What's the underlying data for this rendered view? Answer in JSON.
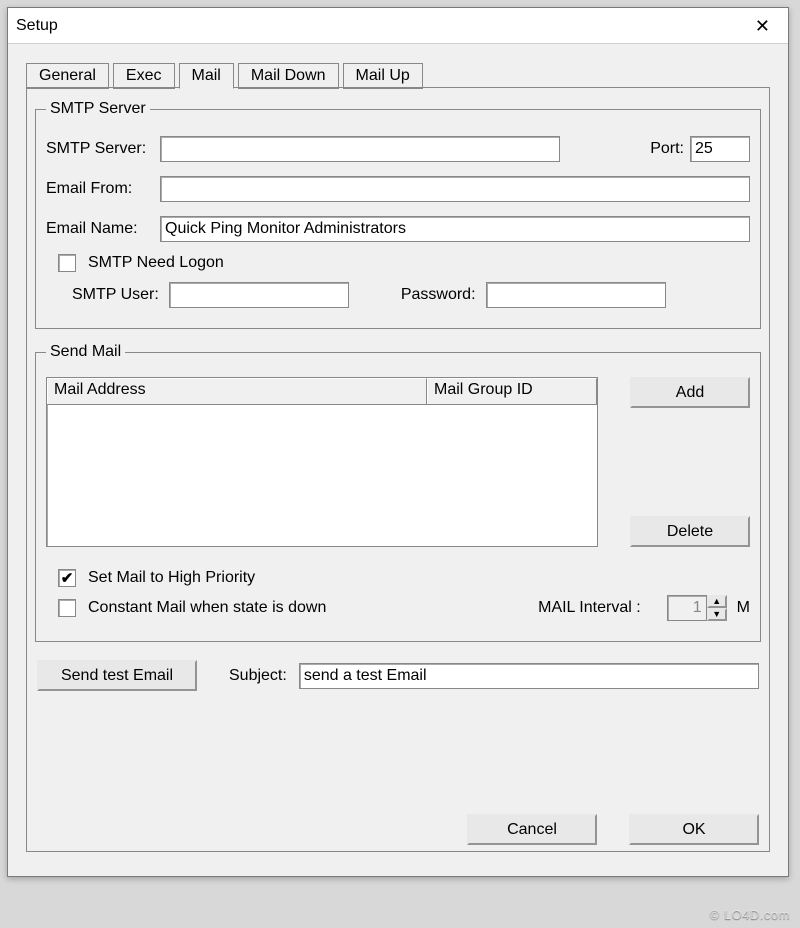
{
  "window": {
    "title": "Setup"
  },
  "tabs": {
    "general": "General",
    "exec": "Exec",
    "mail": "Mail",
    "maildown": "Mail Down",
    "mailup": "Mail Up"
  },
  "smtp": {
    "legend": "SMTP Server",
    "server_label": "SMTP Server:",
    "server_value": "",
    "port_label": "Port:",
    "port_value": "25",
    "emailfrom_label": "Email From:",
    "emailfrom_value": "",
    "emailname_label": "Email Name:",
    "emailname_value": "Quick Ping Monitor Administrators",
    "needlogon_label": "SMTP Need Logon",
    "needlogon_checked": false,
    "user_label": "SMTP User:",
    "user_value": "",
    "password_label": "Password:",
    "password_value": ""
  },
  "sendmail": {
    "legend": "Send Mail",
    "col_address": "Mail Address",
    "col_group": "Mail Group ID",
    "add_label": "Add",
    "delete_label": "Delete",
    "highprio_label": "Set Mail to High Priority",
    "highprio_checked": true,
    "constant_label": "Constant Mail when state is down",
    "constant_checked": false,
    "interval_label": "MAIL Interval :",
    "interval_value": "1",
    "interval_unit": "M"
  },
  "test": {
    "button_label": "Send test Email",
    "subject_label": "Subject:",
    "subject_value": "send a test Email"
  },
  "buttons": {
    "cancel": "Cancel",
    "ok": "OK"
  },
  "watermark": "© LO4D.com"
}
